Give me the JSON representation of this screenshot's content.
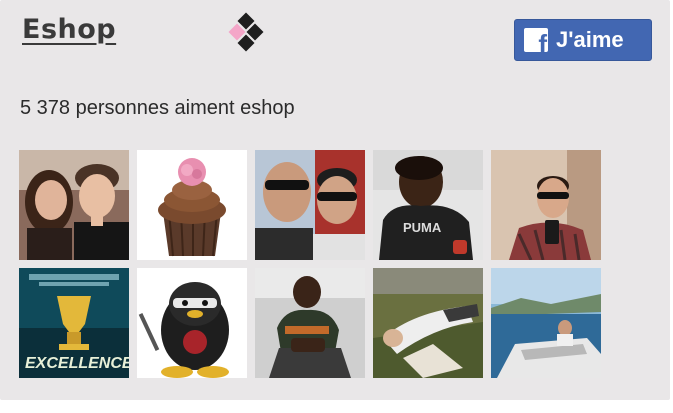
{
  "widget": {
    "page_name": "Eshop",
    "like_button_label": "J'aime",
    "like_count_text": "5 378 personnes aiment eshop"
  },
  "friends": [
    {
      "icon": "couple-photo"
    },
    {
      "icon": "cupcake-photo"
    },
    {
      "icon": "two-men-sunglasses-photo"
    },
    {
      "icon": "puma-shirt-photo"
    },
    {
      "icon": "selfie-photo"
    },
    {
      "icon": "excellence-trophy-photo"
    },
    {
      "icon": "penguin-ninja-photo"
    },
    {
      "icon": "man-sitting-photo"
    },
    {
      "icon": "lying-in-grass-photo"
    },
    {
      "icon": "boat-sea-photo"
    }
  ],
  "colors": {
    "background": "#e9e7e8",
    "facebook_blue": "#4267b2",
    "logo_pink": "#f4a6c8",
    "logo_black": "#1e1e1e"
  }
}
